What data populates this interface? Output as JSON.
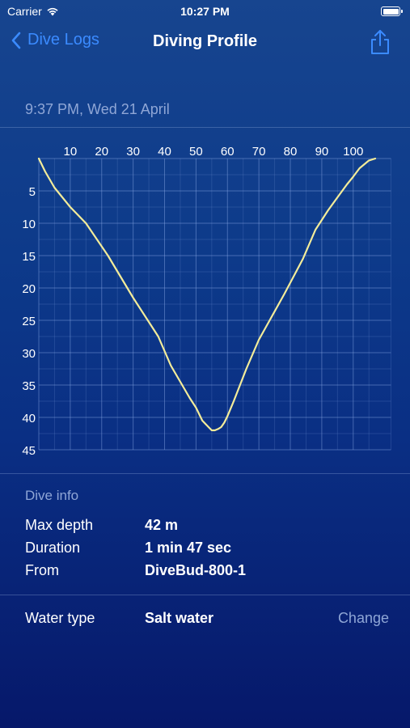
{
  "status": {
    "carrier": "Carrier",
    "time": "10:27 PM"
  },
  "nav": {
    "back_label": "Dive Logs",
    "title": "Diving Profile"
  },
  "timestamp": "9:37 PM, Wed 21 April",
  "chart_data": {
    "type": "line",
    "xlabel": "",
    "ylabel": "",
    "x_ticks": [
      10,
      20,
      30,
      40,
      50,
      60,
      70,
      80,
      90,
      100
    ],
    "y_ticks": [
      5,
      10,
      15,
      20,
      25,
      30,
      35,
      40,
      45
    ],
    "xlim": [
      0,
      107
    ],
    "ylim": [
      0,
      45
    ],
    "y_inverted": true,
    "grid": true,
    "line_color": "#f3ec9a",
    "series": [
      {
        "x": [
          0,
          2,
          5,
          10,
          15,
          22,
          30,
          38,
          42,
          48,
          50,
          52,
          54,
          55,
          56,
          57,
          58,
          59,
          60,
          62,
          64,
          66,
          70,
          74,
          78,
          84,
          88,
          92,
          95,
          98,
          100,
          102,
          104,
          105,
          107
        ],
        "y": [
          0,
          2,
          4.5,
          7.5,
          10,
          15,
          21.5,
          27.5,
          32,
          37,
          38.5,
          40.5,
          41.5,
          42,
          42,
          41.8,
          41.5,
          40.8,
          39.8,
          37.5,
          35,
          32.5,
          28,
          24.5,
          21,
          15.5,
          11,
          8,
          6,
          4,
          2.8,
          1.5,
          0.7,
          0.3,
          0
        ]
      }
    ]
  },
  "dive_info": {
    "title": "Dive info",
    "rows": [
      {
        "label": "Max depth",
        "value": "42 m"
      },
      {
        "label": "Duration",
        "value": "1 min 47 sec"
      },
      {
        "label": "From",
        "value": "DiveBud-800-1"
      }
    ]
  },
  "water": {
    "label": "Water type",
    "value": "Salt water",
    "change_label": "Change"
  },
  "colors": {
    "accent": "#3b8bff",
    "muted": "#8fa6d6",
    "line": "#f3ec9a"
  }
}
